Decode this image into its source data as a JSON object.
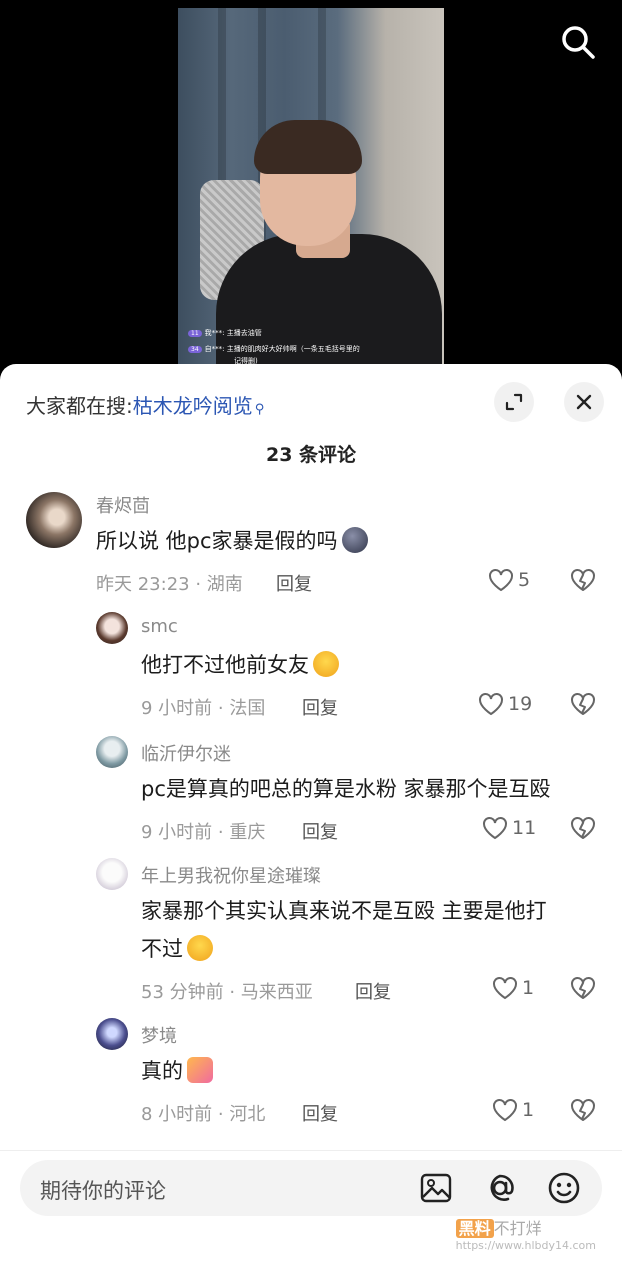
{
  "live": {
    "chat": [
      {
        "level": "11",
        "user": "我***:",
        "text": "主播去油管"
      },
      {
        "level": "34",
        "user": "自***:",
        "text": "主播的肌肉好大好帅啊（一条五毛括号里的"
      },
      {
        "level": "",
        "user": "",
        "text": "记得删)"
      }
    ],
    "search_icon": "search-icon"
  },
  "sheet": {
    "hot_prefix": "大家都在搜:",
    "hot_keyword": "枯木龙吟阅览",
    "comment_count": "23 条评论"
  },
  "comments": [
    {
      "user": "春烬茴",
      "text": "所以说 他pc家暴是假的吗",
      "time": "昨天 23:23 · 湖南",
      "reply": "回复",
      "likes": "5"
    },
    {
      "user": "smc",
      "text": "他打不过他前女友",
      "time": "9 小时前 · 法国",
      "reply": "回复",
      "likes": "19"
    },
    {
      "user": "临沂伊尔迷",
      "text": "pc是算真的吧总的算是水粉 家暴那个是互殴",
      "time": "9 小时前 · 重庆",
      "reply": "回复",
      "likes": "11"
    },
    {
      "user": "年上男我祝你星途璀璨",
      "text": "家暴那个其实认真来说不是互殴 主要是他打",
      "text2": "不过",
      "time": "53 分钟前 · 马来西亚",
      "reply": "回复",
      "likes": "1"
    },
    {
      "user": "梦境",
      "text": "真的",
      "time": "8 小时前 · 河北",
      "reply": "回复",
      "likes": "1"
    }
  ],
  "bottom": {
    "placeholder": "期待你的评论",
    "watermark_a": "黑料",
    "watermark_b": "不打烊",
    "watermark_url": "https://www.hlbdy14.com"
  },
  "colors": {
    "accent_link": "#2b56b3",
    "meta_gray": "#9a9a9a"
  }
}
